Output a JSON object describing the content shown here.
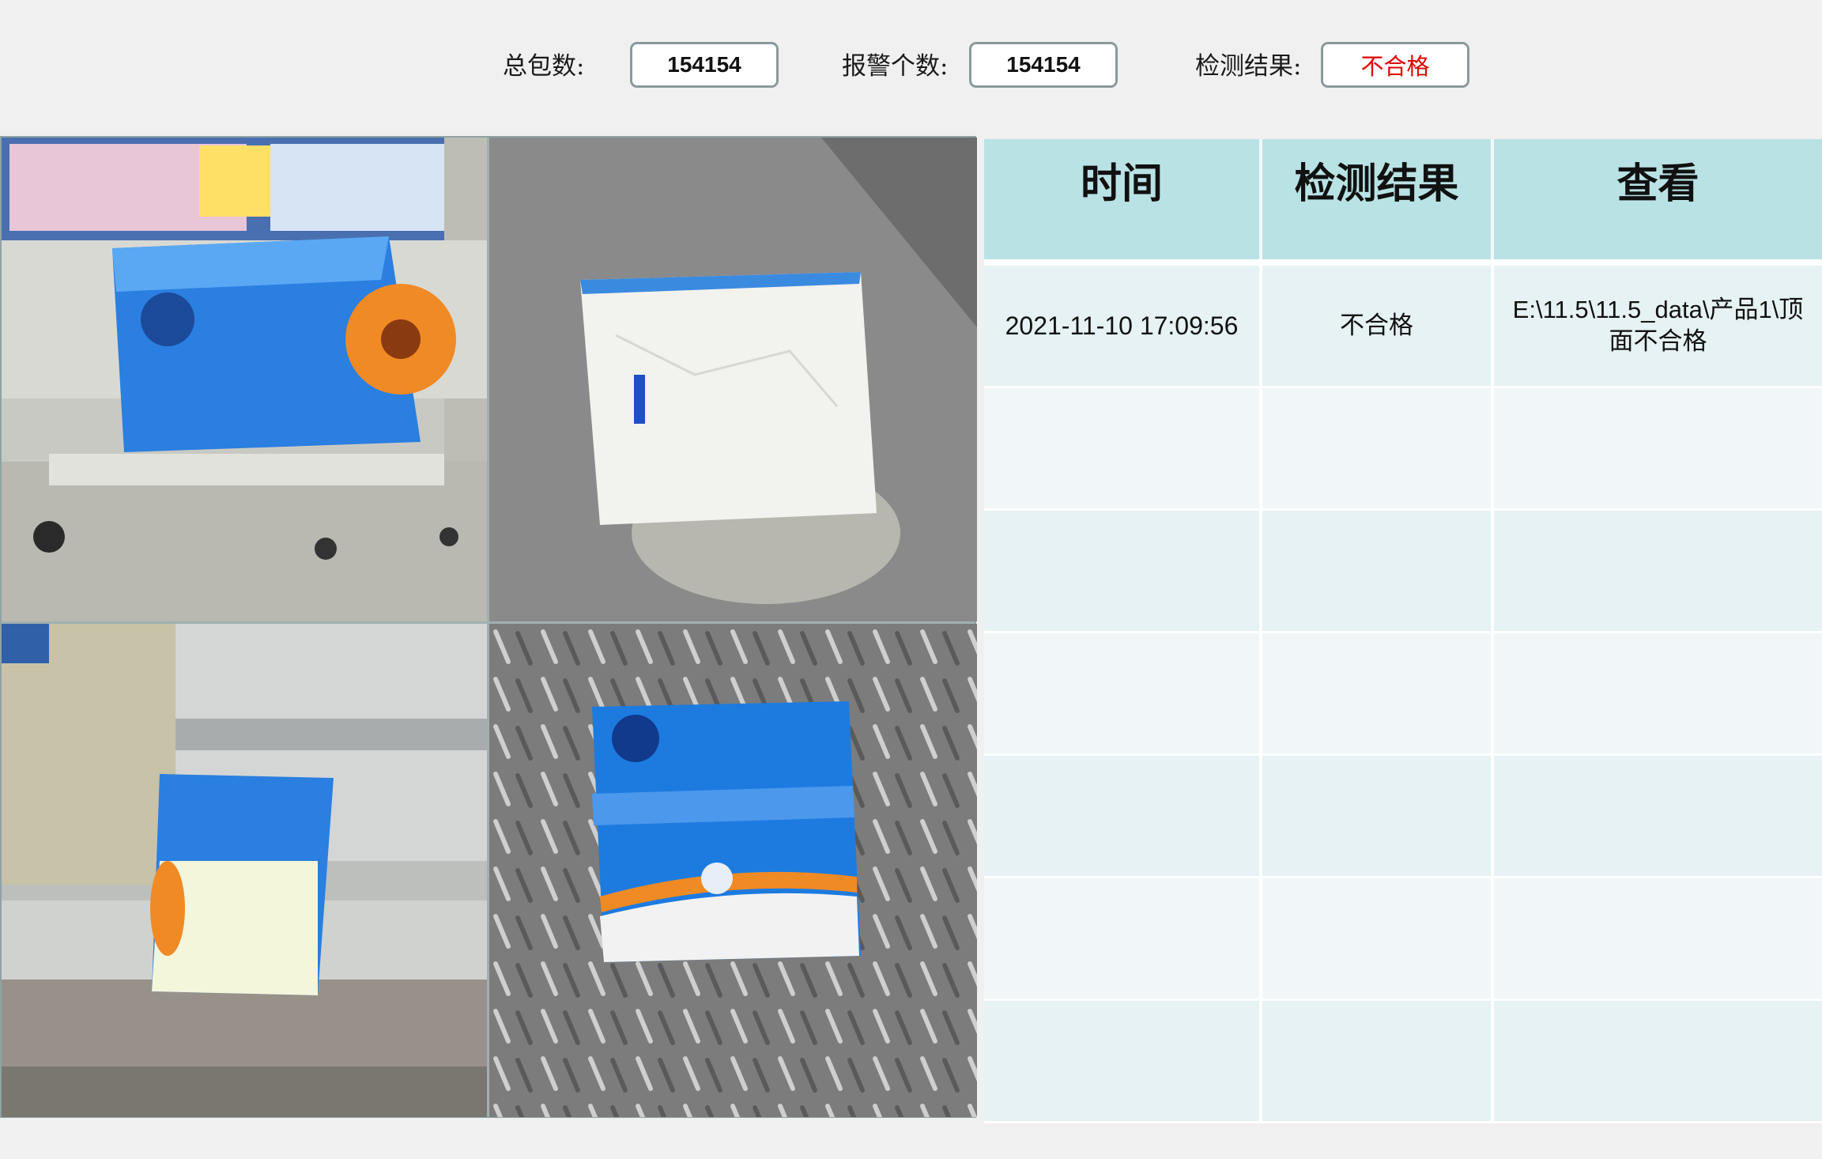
{
  "stats": {
    "total_label": "总包数:",
    "total_value": "154154",
    "alarm_label": "报警个数:",
    "alarm_value": "154154",
    "result_label": "检测结果:",
    "result_value": "不合格",
    "result_color": "#e00000"
  },
  "images": [
    {
      "name": "camera-top-left"
    },
    {
      "name": "camera-top-right"
    },
    {
      "name": "camera-bottom-left"
    },
    {
      "name": "camera-bottom-right"
    }
  ],
  "table": {
    "headers": [
      "时间",
      "检测结果",
      "查看"
    ],
    "rows": [
      {
        "time": "2021-11-10 17:09:56",
        "result": "不合格",
        "view": "E:\\11.5\\11.5_data\\产品1\\顶面不合格"
      },
      {
        "time": "",
        "result": "",
        "view": ""
      },
      {
        "time": "",
        "result": "",
        "view": ""
      },
      {
        "time": "",
        "result": "",
        "view": ""
      },
      {
        "time": "",
        "result": "",
        "view": ""
      },
      {
        "time": "",
        "result": "",
        "view": ""
      },
      {
        "time": "",
        "result": "",
        "view": ""
      }
    ]
  }
}
